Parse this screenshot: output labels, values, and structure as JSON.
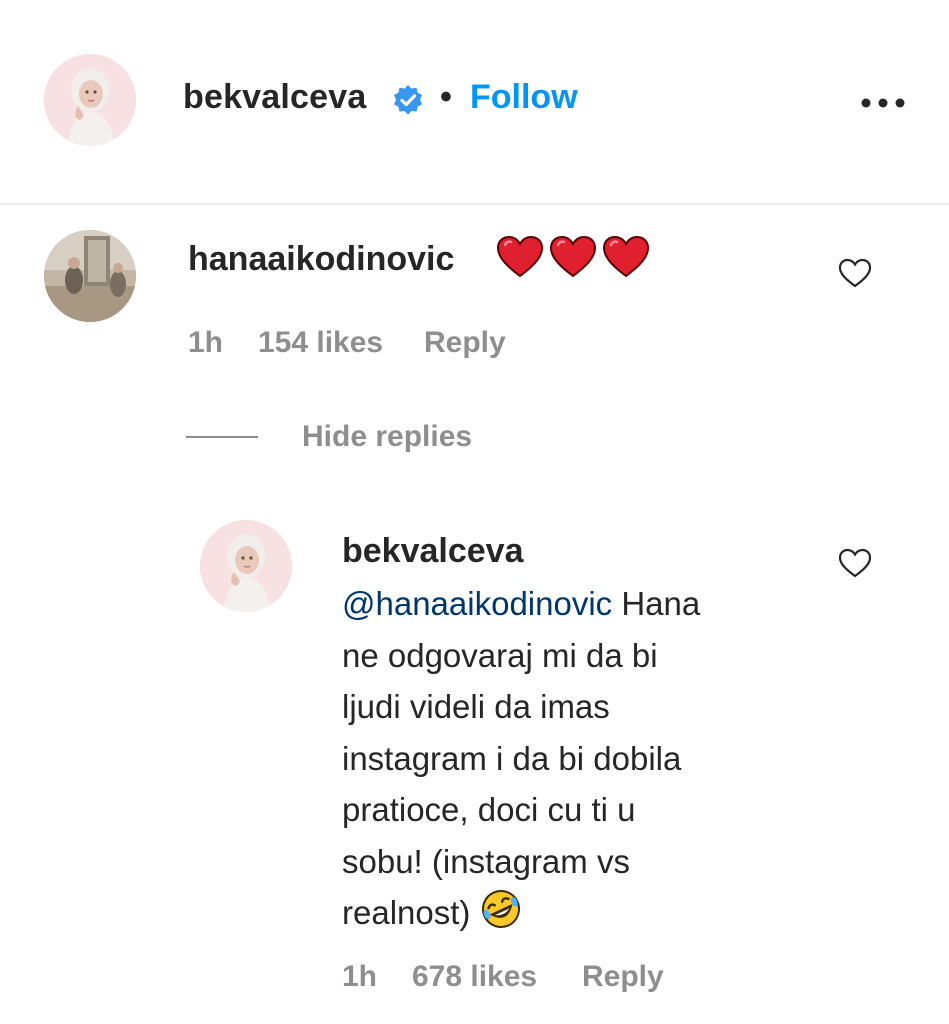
{
  "header": {
    "username": "bekvalceva",
    "separator": "•",
    "follow_label": "Follow",
    "icons": [
      "avatar",
      "verified-badge-icon",
      "more-options-icon"
    ],
    "verified_color": "#3897f0",
    "follow_color": "#0095f6"
  },
  "comments": [
    {
      "username": "hanaaikodinovic",
      "text_icons": [
        "red-heart-emoji",
        "red-heart-emoji",
        "red-heart-emoji"
      ],
      "time": "1h",
      "likes": "154 likes",
      "reply_label": "Reply"
    }
  ],
  "thread": {
    "hide_replies_label": "Hide replies"
  },
  "replies": [
    {
      "username": "bekvalceva",
      "mention": "@hanaaikodinovic",
      "text": " Hana\nne odgovaraj mi da bi\nljudi videli da imas\ninstagram i da bi dobila\npratioce, doci cu ti u\nsobu! (instagram vs\nrealnost) ",
      "emoji": "rolling-on-floor-laughing-emoji",
      "time": "1h",
      "likes": "678 likes",
      "reply_label": "Reply"
    }
  ],
  "colors": {
    "text": "#262626",
    "meta": "#8e8e8e",
    "mention": "#00376b",
    "heart": "#ed4956"
  }
}
